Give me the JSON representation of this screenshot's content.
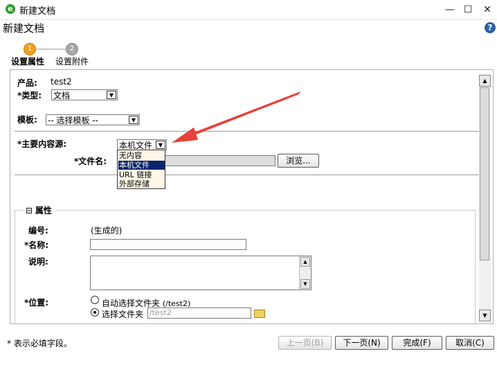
{
  "window": {
    "title": "新建文档",
    "app_icon": "e",
    "minimize": "—",
    "maximize": "☐",
    "close": "✕"
  },
  "header": {
    "title": "新建文档",
    "help": "?"
  },
  "steps": [
    {
      "number": "1",
      "label": "设置属性",
      "active": true
    },
    {
      "number": "2",
      "label": "设置附件",
      "active": false
    }
  ],
  "form": {
    "product_label": "产品:",
    "product_value": "test2",
    "type_label": "类型:",
    "type_value": "文档",
    "template_label": "模板:",
    "template_value": "-- 选择模板 --",
    "source_label": "主要内容源:",
    "source_value": "本机文件",
    "source_options": [
      "无内容",
      "本机文件",
      "URL 链接",
      "外部存储"
    ],
    "source_selected_index": 1,
    "filename_label": "文件名:",
    "browse_button": "浏览...",
    "required_mark": "*"
  },
  "properties": {
    "section_title": "属性",
    "collapse_icon": "⊟",
    "number_label": "编号:",
    "number_value": "(生成的)",
    "name_label": "名称:",
    "desc_label": "说明:",
    "location_label": "位置:",
    "auto_folder_label": "自动选择文件夹",
    "auto_folder_path": "(/test2)",
    "choose_folder_label": "选择文件夹",
    "choose_folder_value": "/test2"
  },
  "footer": {
    "required_note": "* 表示必填字段。",
    "prev_button": "上一页(B)",
    "next_button": "下一页(N)",
    "finish_button": "完成(F)",
    "cancel_button": "取消(C)"
  },
  "colors": {
    "arrow": "#e8403a",
    "accent_step": "#f0a020",
    "selection": "#0a246a"
  }
}
